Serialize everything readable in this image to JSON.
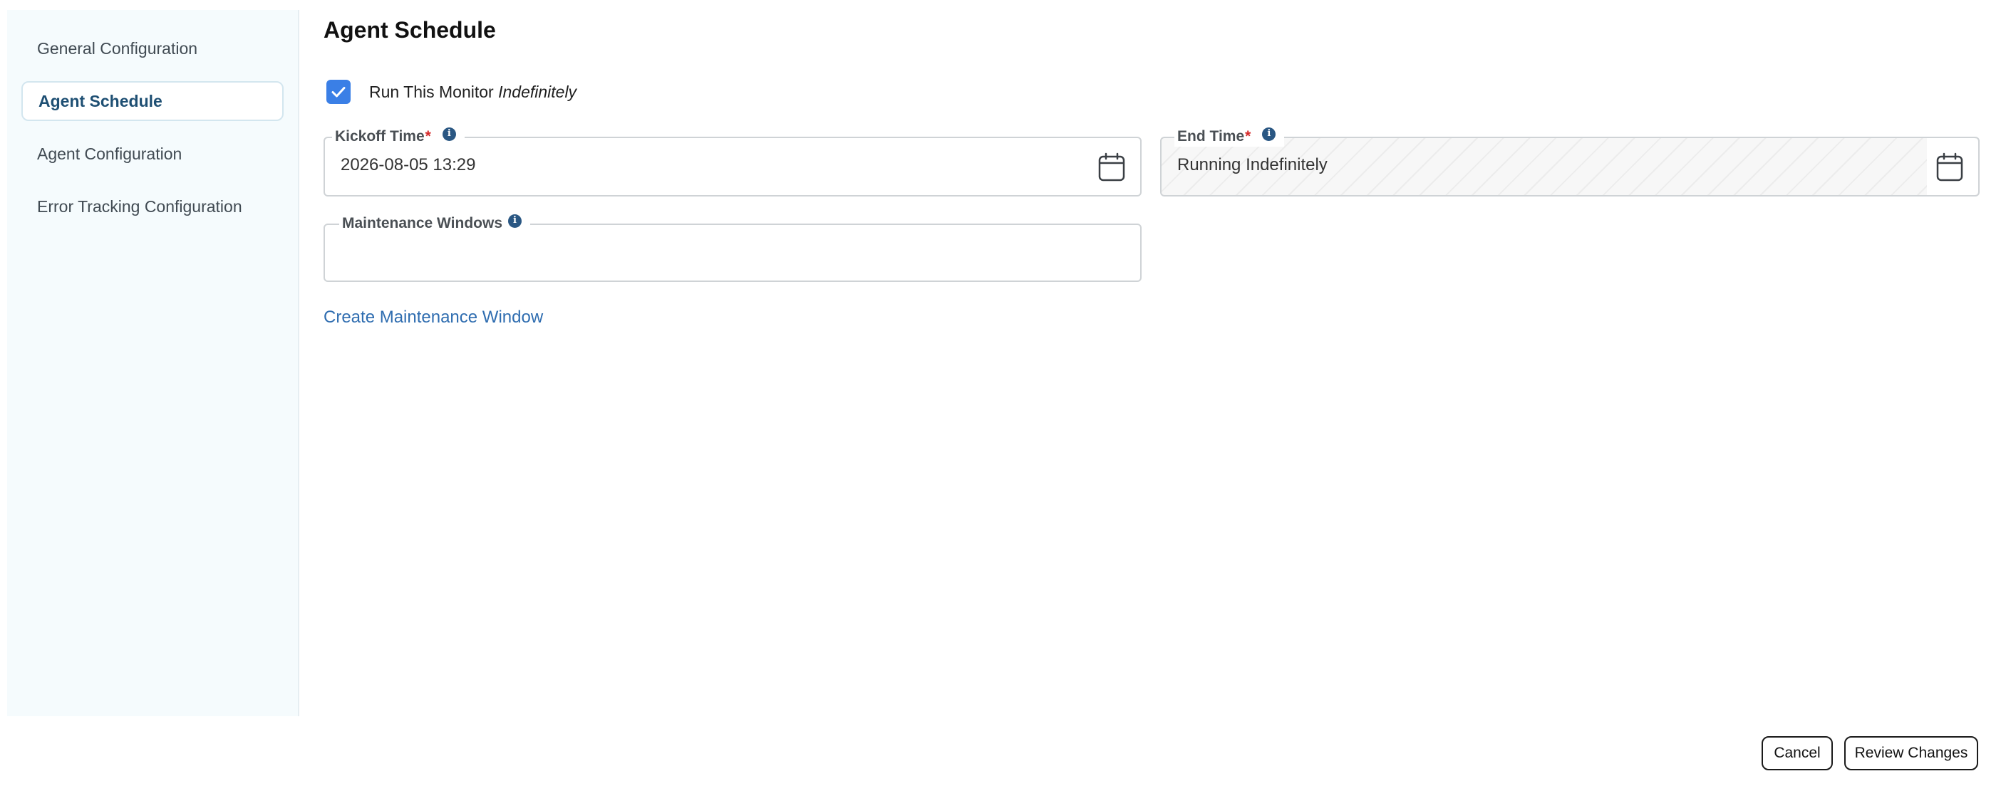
{
  "sidebar": {
    "items": [
      {
        "label": "General Configuration"
      },
      {
        "label": "Agent Schedule",
        "active": true
      },
      {
        "label": "Agent Configuration"
      },
      {
        "label": "Error Tracking Configuration"
      }
    ]
  },
  "main": {
    "title": "Agent Schedule",
    "run_indefinitely": {
      "checked": true,
      "label_prefix": "Run This Monitor",
      "label_emphasis": "Indefinitely"
    },
    "kickoff_time": {
      "label": "Kickoff Time",
      "required_mark": "*",
      "value": "2026-08-05 13:29",
      "info_glyph": "i"
    },
    "end_time": {
      "label": "End Time",
      "required_mark": "*",
      "value": "Running Indefinitely",
      "info_glyph": "i"
    },
    "maintenance_windows": {
      "label": "Maintenance Windows",
      "value": "",
      "info_glyph": "i"
    },
    "create_link": "Create Maintenance Window"
  },
  "footer": {
    "cancel_label": "Cancel",
    "review_label": "Review Changes"
  },
  "colors": {
    "accent": "#3a7fe6",
    "link": "#2f6db0",
    "sidebar_bg": "#f5fbfd",
    "active_text": "#1e4f73",
    "required": "#d42828",
    "info": "#2a5783"
  },
  "icons": {
    "checkbox": "checkmark-icon",
    "calendar": "calendar-icon",
    "info": "info-icon"
  }
}
